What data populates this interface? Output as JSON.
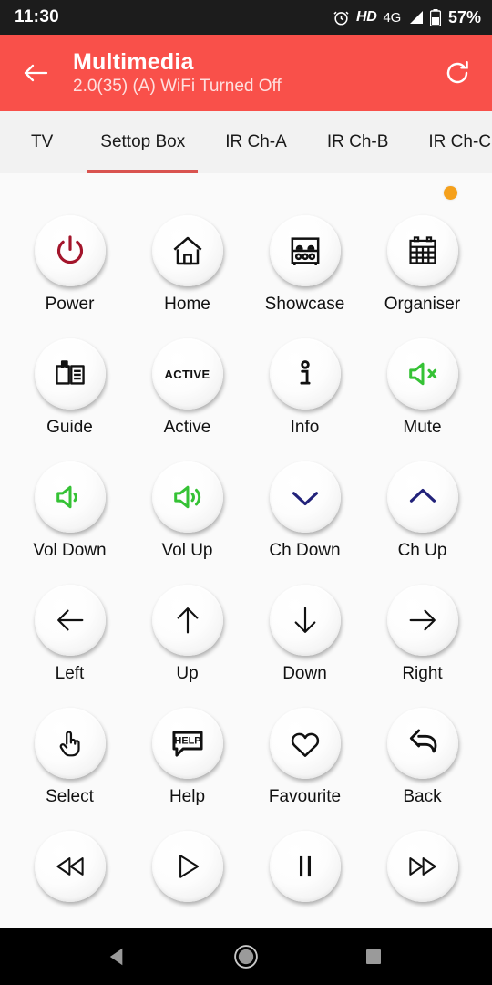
{
  "statusbar": {
    "time": "11:30",
    "hd_label": "HD",
    "network_label": "4G",
    "battery_percent": "57%",
    "icons": {
      "alarm": "alarm-icon",
      "signal": "signal-icon",
      "battery": "battery-icon"
    }
  },
  "appbar": {
    "title": "Multimedia",
    "subtitle": "2.0(35) (A) WiFi Turned Off",
    "back_icon": "back-arrow-icon",
    "refresh_icon": "refresh-icon",
    "background_color": "#f9504a"
  },
  "tabs": {
    "active_index": 1,
    "indicator_color": "#d9534f",
    "items": [
      {
        "label": "TV"
      },
      {
        "label": "Settop Box"
      },
      {
        "label": "IR Ch-A"
      },
      {
        "label": "IR Ch-B"
      },
      {
        "label": "IR Ch-C"
      }
    ]
  },
  "content": {
    "status_dot_color": "#f5a01b",
    "buttons": [
      {
        "label": "Power",
        "icon": "power-icon",
        "color": "#a3152b"
      },
      {
        "label": "Home",
        "icon": "home-icon",
        "color": "#111111"
      },
      {
        "label": "Showcase",
        "icon": "showcase-icon",
        "color": "#111111"
      },
      {
        "label": "Organiser",
        "icon": "calendar-icon",
        "color": "#111111"
      },
      {
        "label": "Guide",
        "icon": "book-icon",
        "color": "#111111"
      },
      {
        "label": "Active",
        "icon": "active-text-icon",
        "color": "#111111",
        "text": "ACTIVE"
      },
      {
        "label": "Info",
        "icon": "info-icon",
        "color": "#111111"
      },
      {
        "label": "Mute",
        "icon": "speaker-mute-icon",
        "color": "#35c235"
      },
      {
        "label": "Vol Down",
        "icon": "volume-down-icon",
        "color": "#35c235"
      },
      {
        "label": "Vol Up",
        "icon": "volume-up-icon",
        "color": "#35c235"
      },
      {
        "label": "Ch Down",
        "icon": "chevron-down-icon",
        "color": "#22227a"
      },
      {
        "label": "Ch Up",
        "icon": "chevron-up-icon",
        "color": "#22227a"
      },
      {
        "label": "Left",
        "icon": "arrow-left-icon",
        "color": "#111111"
      },
      {
        "label": "Up",
        "icon": "arrow-up-icon",
        "color": "#111111"
      },
      {
        "label": "Down",
        "icon": "arrow-down-icon",
        "color": "#111111"
      },
      {
        "label": "Right",
        "icon": "arrow-right-icon",
        "color": "#111111"
      },
      {
        "label": "Select",
        "icon": "pointing-hand-icon",
        "color": "#111111"
      },
      {
        "label": "Help",
        "icon": "help-bubble-icon",
        "color": "#111111",
        "text": "HELP"
      },
      {
        "label": "Favourite",
        "icon": "heart-icon",
        "color": "#111111"
      },
      {
        "label": "Back",
        "icon": "back-curved-arrow-icon",
        "color": "#111111"
      },
      {
        "label": "",
        "icon": "rewind-icon",
        "color": "#111111"
      },
      {
        "label": "",
        "icon": "play-icon",
        "color": "#111111"
      },
      {
        "label": "",
        "icon": "pause-icon",
        "color": "#111111"
      },
      {
        "label": "",
        "icon": "fast-forward-icon",
        "color": "#111111"
      }
    ]
  },
  "navbar": {
    "back_icon": "nav-back-icon",
    "home_icon": "nav-home-icon",
    "recents_icon": "nav-recents-icon"
  }
}
